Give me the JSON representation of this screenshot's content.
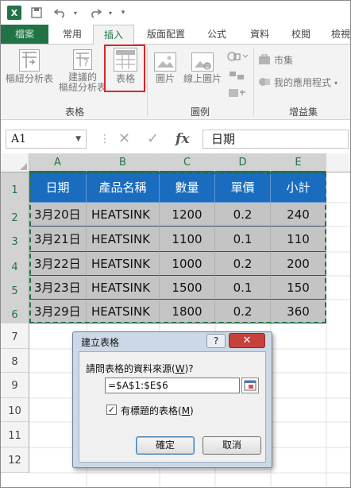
{
  "quick_access": {
    "app_logo": "X",
    "save_icon": "save-icon",
    "undo_icon": "undo-icon",
    "redo_icon": "redo-icon",
    "customize_icon": "customize-icon"
  },
  "tabs": [
    {
      "label": "檔案"
    },
    {
      "label": "常用"
    },
    {
      "label": "插入"
    },
    {
      "label": "版面配置"
    },
    {
      "label": "公式"
    },
    {
      "label": "資料"
    },
    {
      "label": "校閱"
    },
    {
      "label": "檢視"
    }
  ],
  "active_tab": "插入",
  "ribbon": {
    "pivot_line1": "樞紐分析表",
    "rec_pivot_line1": "建議的",
    "rec_pivot_line2": "樞紐分析表",
    "table": "表格",
    "group_tables": "表格",
    "picture": "圖片",
    "online_picture": "線上圖片",
    "group_illustrations": "圖例",
    "store": "市集",
    "my_apps": "我的應用程式",
    "group_addins": "增益集"
  },
  "formula_bar": {
    "name_box": "A1",
    "cancel_symbol": "✕",
    "enter_symbol": "✓",
    "fx_symbol": "fx",
    "formula": "日期"
  },
  "sheet": {
    "columns": [
      "A",
      "B",
      "C",
      "D",
      "E"
    ],
    "rows": [
      "1",
      "2",
      "3",
      "4",
      "5",
      "6",
      "7",
      "8",
      "9",
      "10",
      "11",
      "12"
    ],
    "header": [
      "日期",
      "產品名稱",
      "數量",
      "單價",
      "小計"
    ],
    "data": [
      [
        "3月20日",
        "HEATSINK",
        "1200",
        "0.2",
        "240"
      ],
      [
        "3月21日",
        "HEATSINK",
        "1100",
        "0.1",
        "110"
      ],
      [
        "3月22日",
        "HEATSINK",
        "1000",
        "0.2",
        "200"
      ],
      [
        "3月23日",
        "HEATSINK",
        "1500",
        "0.1",
        "150"
      ],
      [
        "3月29日",
        "HEATSINK",
        "1800",
        "0.2",
        "360"
      ]
    ]
  },
  "dialog": {
    "title": "建立表格",
    "help": "?",
    "close": "✕",
    "prompt": "請問表格的資料來源(",
    "prompt_key": "W",
    "prompt_end": ")?",
    "range": "=$A$1:$E$6",
    "checkbox_label": "有標題的表格(",
    "checkbox_key": "M",
    "checkbox_end": ")",
    "checkbox_mark": "✓",
    "ok": "確定",
    "cancel": "取消"
  },
  "colors": {
    "excel_green": "#217346",
    "header_blue": "#1a6cbf",
    "data_gray": "#c4c4c4",
    "highlight_red": "#d9252a"
  }
}
